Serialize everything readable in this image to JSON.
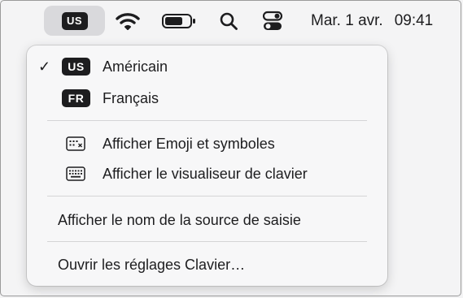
{
  "menubar": {
    "input_source_badge": "US",
    "date": "Mar. 1 avr.",
    "time": "09:41"
  },
  "menu": {
    "sources": [
      {
        "badge": "US",
        "label": "Américain",
        "checked": true
      },
      {
        "badge": "FR",
        "label": "Français",
        "checked": false
      }
    ],
    "check_mark": "✓",
    "show_emoji_label": "Afficher Emoji et symboles",
    "show_keyboard_viewer_label": "Afficher le visualiseur de clavier",
    "show_input_source_name_label": "Afficher le nom de la source de saisie",
    "open_keyboard_settings_label": "Ouvrir les réglages Clavier…"
  },
  "icons": {
    "wifi": "wifi-icon",
    "battery": "battery-icon",
    "search": "search-icon",
    "control_center": "control-center-icon",
    "emoji": "emoji-viewer-icon",
    "keyboard": "keyboard-viewer-icon"
  },
  "colors": {
    "badge_bg": "#1d1d1f",
    "menu_bg": "#f7f7f8",
    "chip_bg": "#d9d9dc"
  }
}
